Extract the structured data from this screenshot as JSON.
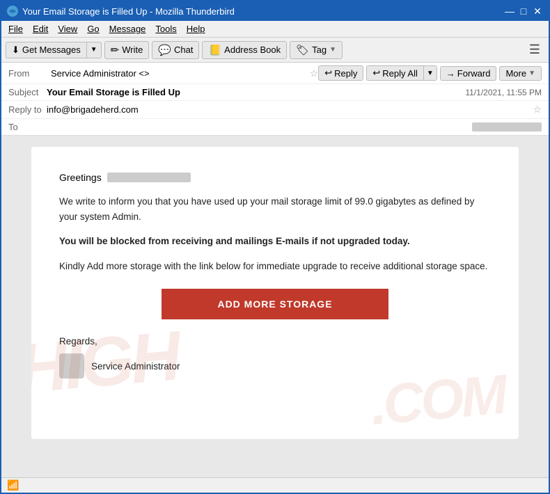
{
  "titleBar": {
    "title": "Your Email Storage is Filled Up - Mozilla Thunderbird",
    "iconLabel": "T",
    "controls": {
      "minimize": "—",
      "maximize": "□",
      "close": "✕"
    }
  },
  "menuBar": {
    "items": [
      "File",
      "Edit",
      "View",
      "Go",
      "Message",
      "Tools",
      "Help"
    ]
  },
  "toolbar": {
    "getMessages": "Get Messages",
    "write": "Write",
    "chat": "Chat",
    "addressBook": "Address Book",
    "tag": "Tag"
  },
  "emailHeader": {
    "fromLabel": "From",
    "fromValue": "Service Administrator <>",
    "subjectLabel": "Subject",
    "subjectValue": "Your Email Storage is Filled Up",
    "replyToLabel": "Reply to",
    "replyToValue": "info@brigadeherd.com",
    "toLabel": "To",
    "date": "11/1/2021, 11:55 PM",
    "actions": {
      "reply": "Reply",
      "replyAll": "Reply All",
      "forward": "Forward",
      "more": "More"
    }
  },
  "emailBody": {
    "greeting": "Greetings",
    "paragraph1": "We write to inform you that you have used up your mail storage limit of 99.0 gigabytes as defined by your system Admin.",
    "paragraph2bold": "You will be blocked from receiving and mailings E-mails if not upgraded today.",
    "paragraph3": "Kindly Add more storage with the link below for immediate upgrade to receive additional storage space.",
    "ctaButton": "ADD MORE STORAGE",
    "regards": "Regards,",
    "signatureName": "Service Administrator",
    "watermarkText": "HIGH.COM"
  },
  "statusBar": {
    "wifiIcon": "📶"
  }
}
